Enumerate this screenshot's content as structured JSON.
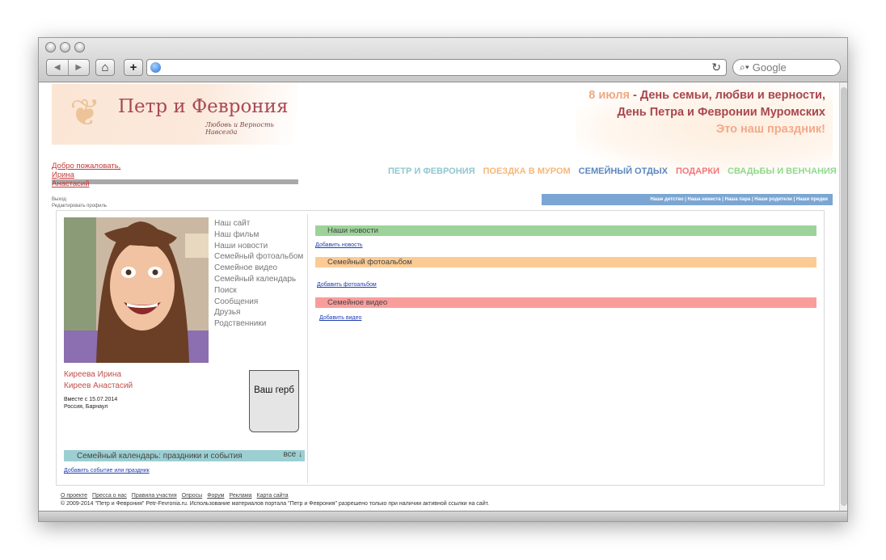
{
  "browser": {
    "search_placeholder": "Google"
  },
  "header": {
    "site_title": "Петр и Феврония",
    "site_subtitle": "Любовь и Верность Навсегда",
    "headline_date": "8 июля",
    "headline_rest1": " - День семьи, любви и верности,",
    "headline_line2": "День Петра и Февронии Муромских",
    "headline_line3": "Это наш праздник!"
  },
  "welcome": {
    "greeting": "Добро пожаловать,",
    "name1": "Ирина",
    "name2": "Анастасий",
    "logout": "Выход",
    "edit_profile": "Редактировать профиль"
  },
  "topnav": [
    {
      "label": "ПЕТР И ФЕВРОНИЯ",
      "color": "#8fc8cf"
    },
    {
      "label": "ПОЕЗДКА В МУРОМ",
      "color": "#f7b77b"
    },
    {
      "label": "СЕМЕЙНЫЙ ОТДЫХ",
      "color": "#5b87bf"
    },
    {
      "label": "ПОДАРКИ",
      "color": "#f0787b"
    },
    {
      "label": "СВАДЬБЫ И ВЕНЧАНИЯ",
      "color": "#8fd98b"
    }
  ],
  "subnav": "Наше детство | Наша невеста | Наша пара | Наши родители | Наши предки",
  "sidemenu": [
    "Наш сайт",
    "Наш фильм",
    "Наши новости",
    "Семейный фотоальбом",
    "Семейное видео",
    "Семейный календарь",
    "Поиск",
    "Сообщения",
    "Друзья",
    "Родственники"
  ],
  "profile": {
    "name1": "Киреева Ирина",
    "name2": "Киреев Анастасий",
    "together_since": "Вместе с 15.07.2014",
    "location": "Россия, Барнаул",
    "crest_label": "Ваш герб"
  },
  "calendar": {
    "title": "Семейный календарь: праздники и события",
    "all_label": "все ↓",
    "add_link": "Добавить событие или праздник"
  },
  "sections": {
    "news_title": "Наши новости",
    "news_add": "Добавить новость",
    "album_title": "Семейный фотоальбом",
    "album_add": "Добавить фотоальбом",
    "video_title": "Семейное видео",
    "video_add": "Добавить видео"
  },
  "footer": {
    "links": [
      "О проекте",
      "Пресса о нас",
      "Правила участия",
      "Опросы",
      "Форум",
      "Реклама",
      "Карта сайта"
    ],
    "copyright": "© 2009-2014 \"Петр и Феврония\" Petr-Fevronia.ru. Использование материалов портала \"Петр и Феврония\" разрешено только при наличии активной ссылки на сайт."
  },
  "colors": {
    "news_bar": "#9dd39a",
    "album_bar": "#fccb93",
    "video_bar": "#f99d9b",
    "calendar_bar": "#9ccfd2",
    "subnav_bar": "#7ba6d4"
  }
}
